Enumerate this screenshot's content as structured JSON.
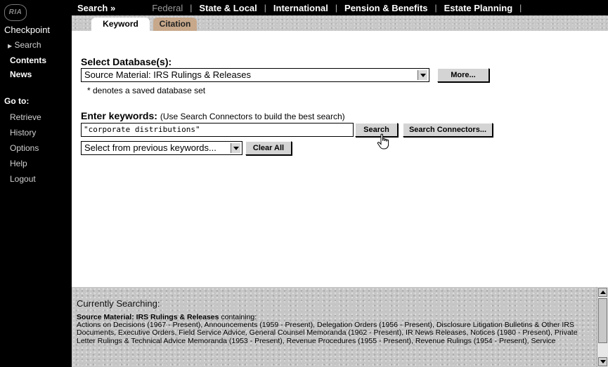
{
  "sidebar": {
    "logo": "RIA",
    "product": "Checkpoint",
    "nav": [
      "Search",
      "Contents",
      "News"
    ],
    "goto_label": "Go to:",
    "goto_items": [
      "Retrieve",
      "History",
      "Options",
      "Help",
      "Logout"
    ]
  },
  "topbar": {
    "search": "Search »",
    "links": [
      "Federal",
      "State & Local",
      "International",
      "Pension & Benefits",
      "Estate Planning"
    ]
  },
  "tabs": [
    "Keyword",
    "Citation"
  ],
  "database": {
    "label": "Select Database(s):",
    "selected": "Source Material: IRS Rulings & Releases",
    "more_button": "More...",
    "note": "* denotes a saved database set"
  },
  "keywords": {
    "label": "Enter keywords:",
    "hint": "(Use Search Connectors to build the best search)",
    "value": "\"corporate distributions\"",
    "search_button": "Search",
    "connectors_button": "Search Connectors...",
    "previous_select": "Select from previous keywords...",
    "clear_button": "Clear All"
  },
  "currently": {
    "label": "Currently Searching:",
    "source": "Source Material: IRS Rulings & Releases",
    "containing": "containing:",
    "details": "Actions on Decisions (1967 - Present), Announcements (1959 - Present), Delegation Orders (1956 - Present), Disclosure Litigation Bulletins & Other IRS Documents, Executive Orders, Field Service Advice, General Counsel Memoranda (1962 - Present), IR News Releases, Notices (1980 - Present), Private Letter Rulings & Technical Advice Memoranda (1953 - Present), Revenue Procedures (1955 - Present), Revenue Rulings (1954 - Present), Service"
  }
}
